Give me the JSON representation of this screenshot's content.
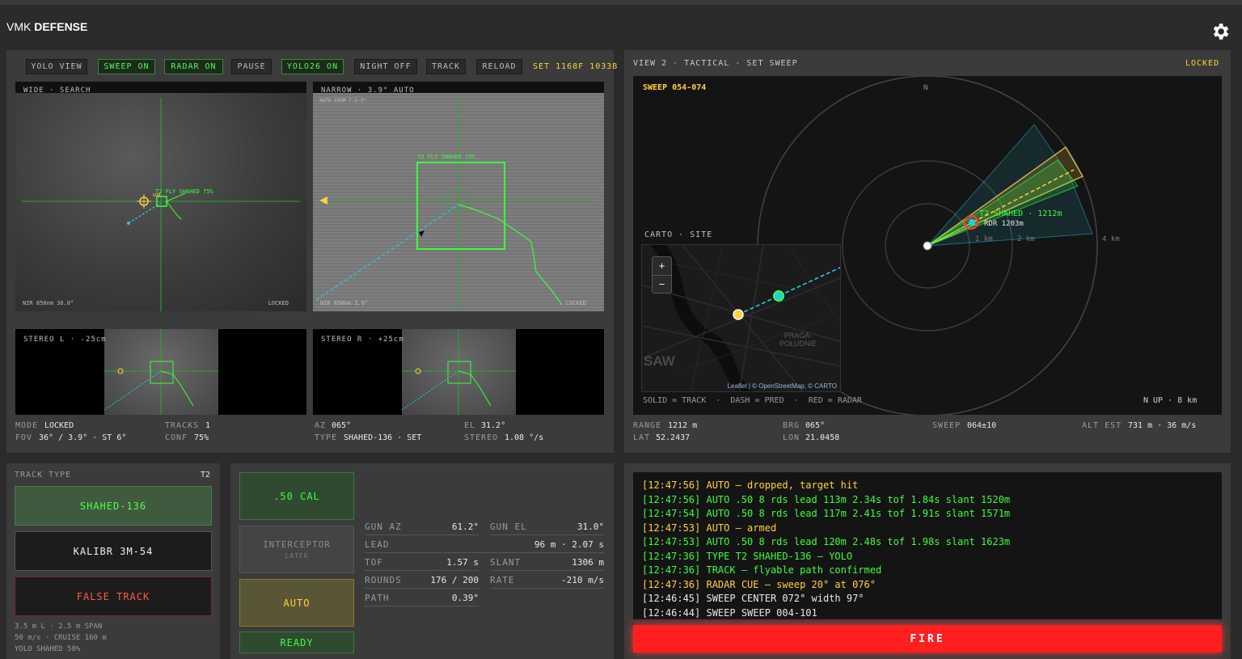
{
  "app": {
    "title_prefix": "VMK",
    "title_main": "DEFENSE"
  },
  "toolbar": {
    "buttons": [
      {
        "label": "YOLO VIEW",
        "on": false
      },
      {
        "label": "SWEEP ON",
        "on": true
      },
      {
        "label": "RADAR ON",
        "on": true
      },
      {
        "label": "PAUSE",
        "on": false
      },
      {
        "label": "YOLO26 ON",
        "on": true
      },
      {
        "label": "NIGHT OFF",
        "on": false
      },
      {
        "label": "TRACK",
        "on": false
      },
      {
        "label": "RELOAD",
        "on": false
      }
    ],
    "set_text": "SET 1168F 1033B"
  },
  "cams": {
    "wide": {
      "title": "WIDE · SEARCH",
      "footer_left": "NIR 850nm  36.0°",
      "footer_right": "LOCKED",
      "target_label": "T2 FLY SHAHED  75%",
      "gun_label": "GUN"
    },
    "narrow": {
      "title": "NARROW · 3.9° AUTO",
      "subtitle": "AUTO ZOOM 7.5-3°",
      "footer_left": "NIR 850nm  3.9°",
      "footer_right": "LOCKED",
      "target_label": "T2 FLY SHAHED  75%"
    },
    "stereo_l": {
      "title": "STEREO L · -25cm"
    },
    "stereo_r": {
      "title": "STEREO R · +25cm"
    }
  },
  "status_left": {
    "mode_label": "MODE",
    "mode_value": "LOCKED",
    "tracks_label": "TRACKS",
    "tracks_value": "1",
    "fov_label": "FOV",
    "fov_value": "36° / 3.9° · ST 6°",
    "conf_label": "CONF",
    "conf_value": "75%",
    "az_label": "AZ",
    "az_value": "065°",
    "el_label": "EL",
    "el_value": "31.2°",
    "type_label": "TYPE",
    "type_value": "SHAHED-136 · SET",
    "stereo_label": "STEREO",
    "stereo_value": "1.08 °/s"
  },
  "tactical": {
    "title": "VIEW 2 · TACTICAL · SET SWEEP",
    "status": "LOCKED",
    "sweep": "SWEEP 054-074",
    "north": "N",
    "ring_labels": [
      "1 km",
      "2 km",
      "4 km"
    ],
    "target_label": "T2 SHAHED · 1212m",
    "radar_label": "RDR 1203m",
    "legend": "SOLID = TRACK  ·  DASH = PRED  ·  RED = RADAR",
    "scale": "N UP · 8 km",
    "map": {
      "title": "CARTO · SITE",
      "zoom_in": "+",
      "zoom_out": "−",
      "city": "SAW",
      "district": "PRAGA-\nPOŁUDNIE",
      "attribution": "Leaflet | © OpenStreetMap, © CARTO"
    }
  },
  "status_right": {
    "range_label": "RANGE",
    "range_value": "1212 m",
    "brg_label": "BRG",
    "brg_value": "065°",
    "sweep_label": "SWEEP",
    "sweep_value": "064±10",
    "alt_label": "ALT EST",
    "alt_value": "731 m · 36 m/s",
    "lat_label": "LAT",
    "lat_value": "52.2437",
    "lon_label": "LON",
    "lon_value": "21.0458"
  },
  "track_type": {
    "title": "TRACK TYPE",
    "id": "T2",
    "options": [
      {
        "label": "SHAHED-136"
      },
      {
        "label": "KALIBR 3M-54"
      },
      {
        "label": "FALSE TRACK"
      }
    ],
    "specs": [
      "3.5 m L · 2.5 m SPAN",
      "50 m/s · CRUISE 160 m",
      "YOLO SHAHED 58%"
    ]
  },
  "weapons": {
    "cal": ".50 CAL",
    "interceptor": "INTERCEPTOR",
    "interceptor_sub": "LATER",
    "auto": "AUTO",
    "ready": "READY",
    "gun_az_label": "GUN AZ",
    "gun_az": "61.2°",
    "gun_el_label": "GUN EL",
    "gun_el": "31.0°",
    "lead_label": "LEAD",
    "lead": "96 m · 2.07 s",
    "tof_label": "TOF",
    "tof": "1.57 s",
    "slant_label": "SLANT",
    "slant": "1306 m",
    "rounds_label": "ROUNDS",
    "rounds": "176 / 200",
    "rate_label": "RATE",
    "rate": "-210 m/s",
    "path_label": "PATH",
    "path": "0.39°"
  },
  "log": [
    {
      "text": "[12:47:56] AUTO — dropped, target hit",
      "color": "yellow"
    },
    {
      "text": "[12:47:56] AUTO .50 8 rds lead 113m 2.34s tof 1.84s slant 1520m",
      "color": "green"
    },
    {
      "text": "[12:47:54] AUTO .50 8 rds lead 117m 2.41s tof 1.91s slant 1571m",
      "color": "green"
    },
    {
      "text": "[12:47:53] AUTO — armed",
      "color": "yellow"
    },
    {
      "text": "[12:47:53] AUTO .50 8 rds lead 120m 2.48s tof 1.98s slant 1623m",
      "color": "green"
    },
    {
      "text": "[12:47:36] TYPE T2 SHAHED-136 — YOLO",
      "color": "green"
    },
    {
      "text": "[12:47:36] TRACK — flyable path confirmed",
      "color": "green"
    },
    {
      "text": "[12:47:36] RADAR CUE — sweep 20° at 076°",
      "color": "yellow"
    },
    {
      "text": "[12:46:45] SWEEP CENTER 072° width 97°",
      "color": "white"
    },
    {
      "text": "[12:46:44] SWEEP SWEEP 004-101",
      "color": "white"
    }
  ],
  "fire_label": "FIRE",
  "colors": {
    "green": "#3cff3c",
    "yellow": "#ffd23c",
    "red": "#ff1f1f",
    "cyan": "#28c8e8"
  }
}
